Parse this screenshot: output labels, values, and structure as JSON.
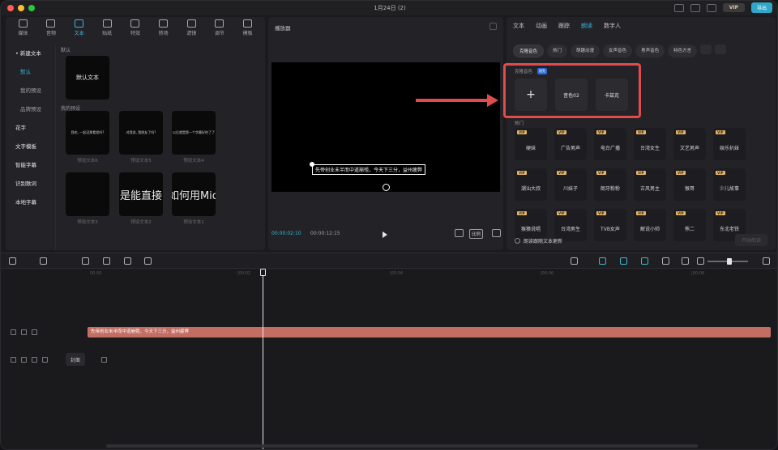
{
  "titlebar": {
    "dots": [
      "#ff5f57",
      "#febc2e",
      "#28c840"
    ],
    "title": "1月24日 (2)",
    "subtitle": "",
    "vip_label": "VIP",
    "export_label": "导出"
  },
  "toolbar": {
    "tools": [
      {
        "label": "媒体",
        "icon": "media-icon"
      },
      {
        "label": "音频",
        "icon": "audio-icon"
      },
      {
        "label": "文本",
        "icon": "text-icon",
        "active": true
      },
      {
        "label": "贴纸",
        "icon": "sticker-icon"
      },
      {
        "label": "特效",
        "icon": "effects-icon"
      },
      {
        "label": "转场",
        "icon": "transition-icon"
      },
      {
        "label": "滤镜",
        "icon": "filter-icon"
      },
      {
        "label": "调节",
        "icon": "adjust-icon"
      },
      {
        "label": "模板",
        "icon": "template-icon"
      }
    ],
    "accent": "#3ab7d8"
  },
  "sidebar": {
    "items": [
      {
        "label": "• 新建文本",
        "type": "head"
      },
      {
        "label": "默认",
        "type": "sub",
        "selected": true
      },
      {
        "label": "我的预设",
        "type": "sub"
      },
      {
        "label": "品牌预设",
        "type": "sub"
      },
      {
        "label": "花字",
        "type": "head"
      },
      {
        "label": "文字模板",
        "type": "head"
      },
      {
        "label": "智能字幕",
        "type": "head"
      },
      {
        "label": "识别歌词",
        "type": "head"
      },
      {
        "label": "本地字幕",
        "type": "head"
      }
    ]
  },
  "content": {
    "default_section": "默认",
    "default_card": "默认文本",
    "preset_section": "我的预设",
    "presets": [
      {
        "preview": "我也, 一起没那看程吗?",
        "caption": "预设文本6"
      },
      {
        "preview": "对我说, 我朋友了吗?",
        "caption": "预设文本5"
      },
      {
        "preview": "以后就是第一个字幕好的了了",
        "caption": "预设文本4"
      },
      {
        "preview": "",
        "caption": "预设文本3"
      },
      {
        "preview": "是能直接",
        "caption": "预设文本2"
      },
      {
        "preview": "如何用Mid",
        "caption": "预设文本1"
      }
    ]
  },
  "player": {
    "title": "播放器",
    "subtitle_text": "先帝创业未半而中道崩殂，今天下三分，益州疲弊",
    "time_current": "00:00:02:10",
    "time_total": "00:00:12:15",
    "ratio_label": "比例"
  },
  "right_panel": {
    "tabs": [
      {
        "label": "文本"
      },
      {
        "label": "动画"
      },
      {
        "label": "跟踪"
      },
      {
        "label": "朗读",
        "active": true
      },
      {
        "label": "数字人"
      }
    ],
    "chips": [
      {
        "label": "克隆音色",
        "active": true
      },
      {
        "label": "热门"
      },
      {
        "label": "萌趣动漫"
      },
      {
        "label": "女声音色"
      },
      {
        "label": "男声音色"
      },
      {
        "label": "特色方言"
      }
    ],
    "clone_label": "克隆音色",
    "clone_badge": "限免",
    "clone_tiles": [
      "+",
      "音色02",
      "卡兹克"
    ],
    "hot_label": "热门",
    "voice_tag": "VIP",
    "voices": [
      "硬妹",
      "广告男声",
      "电台广播",
      "台湾女生",
      "文艺男声",
      "娱乐扒妹",
      "潮汕大叔",
      "川妹子",
      "朗牙粉粉",
      "古风男主",
      "猴哥",
      "少儿故事",
      "猴猿说唱",
      "台湾男生",
      "TVB女声",
      "解说小帅",
      "熊二",
      "东北老铁"
    ],
    "footer_check": "朗读跟随文本更新",
    "footer_button": "开始朗读"
  },
  "timeline": {
    "ruler": [
      "00:00",
      "|00:02",
      "|00:04",
      "|00:06",
      "|00:08"
    ],
    "text_clip": "先帝创业未半而中道崩殂，今天下三分，益州疲弊",
    "cover_label": "封面"
  }
}
